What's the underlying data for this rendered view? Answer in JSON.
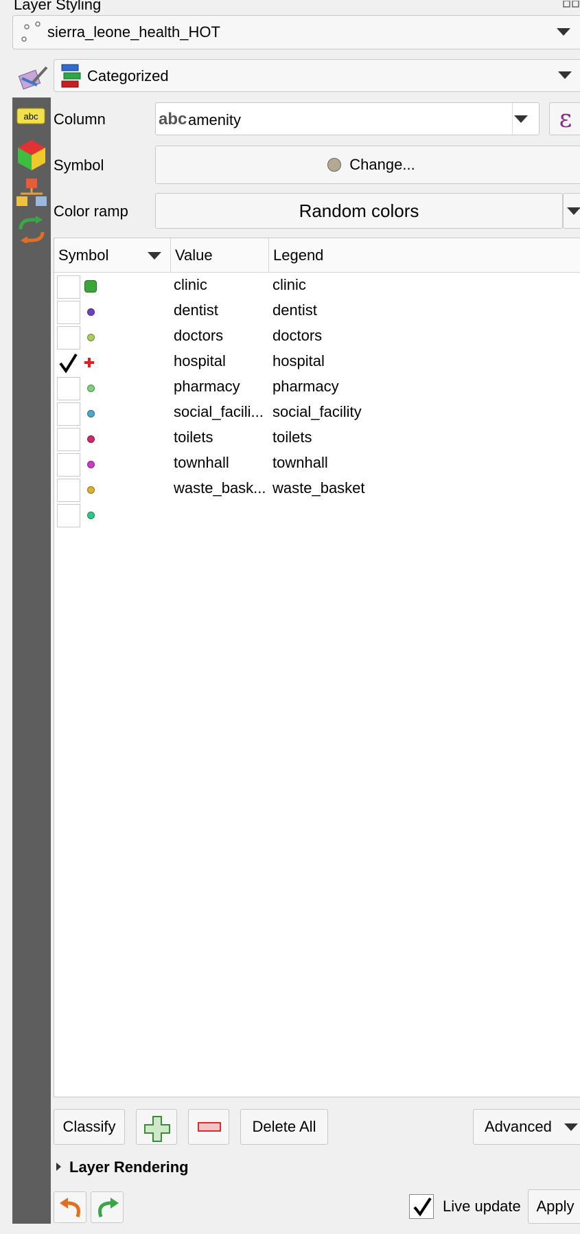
{
  "panel": {
    "title": "Layer Styling"
  },
  "layer_select": {
    "value": "sierra_leone_health_HOT"
  },
  "renderer_select": {
    "value": "Categorized"
  },
  "column": {
    "label": "Column",
    "type_tag": "abc",
    "value": "amenity"
  },
  "symbol": {
    "label": "Symbol",
    "button_label": "Change...",
    "color": "#b3a98f"
  },
  "color_ramp": {
    "label": "Color ramp",
    "value": "Random colors"
  },
  "table": {
    "headers": {
      "symbol": "Symbol",
      "value": "Value",
      "legend": "Legend"
    },
    "rows": [
      {
        "checked": false,
        "value": "clinic",
        "legend": "clinic",
        "color": "#3aa63a",
        "shape": "square"
      },
      {
        "checked": false,
        "value": "dentist",
        "legend": "dentist",
        "color": "#6e3fc7",
        "shape": "dot"
      },
      {
        "checked": false,
        "value": "doctors",
        "legend": "doctors",
        "color": "#a6cf5c",
        "shape": "dot"
      },
      {
        "checked": true,
        "value": "hospital",
        "legend": "hospital",
        "color": "#e02020",
        "shape": "cross"
      },
      {
        "checked": false,
        "value": "pharmacy",
        "legend": "pharmacy",
        "color": "#7fcf7f",
        "shape": "dot"
      },
      {
        "checked": false,
        "value": "social_facili...",
        "legend": "social_facility",
        "color": "#4aa8c8",
        "shape": "dot"
      },
      {
        "checked": false,
        "value": "toilets",
        "legend": "toilets",
        "color": "#cf2a6a",
        "shape": "dot"
      },
      {
        "checked": false,
        "value": "townhall",
        "legend": "townhall",
        "color": "#c93ac9",
        "shape": "dot"
      },
      {
        "checked": false,
        "value": "waste_bask...",
        "legend": "waste_basket",
        "color": "#e0b030",
        "shape": "dot"
      },
      {
        "checked": false,
        "value": "",
        "legend": "",
        "color": "#2ac98a",
        "shape": "dot"
      }
    ]
  },
  "buttons": {
    "classify": "Classify",
    "delete_all": "Delete All",
    "advanced": "Advanced"
  },
  "layer_rendering": {
    "label": "Layer Rendering"
  },
  "footer": {
    "live_update": "Live update",
    "live_update_checked": true,
    "apply": "Apply"
  }
}
